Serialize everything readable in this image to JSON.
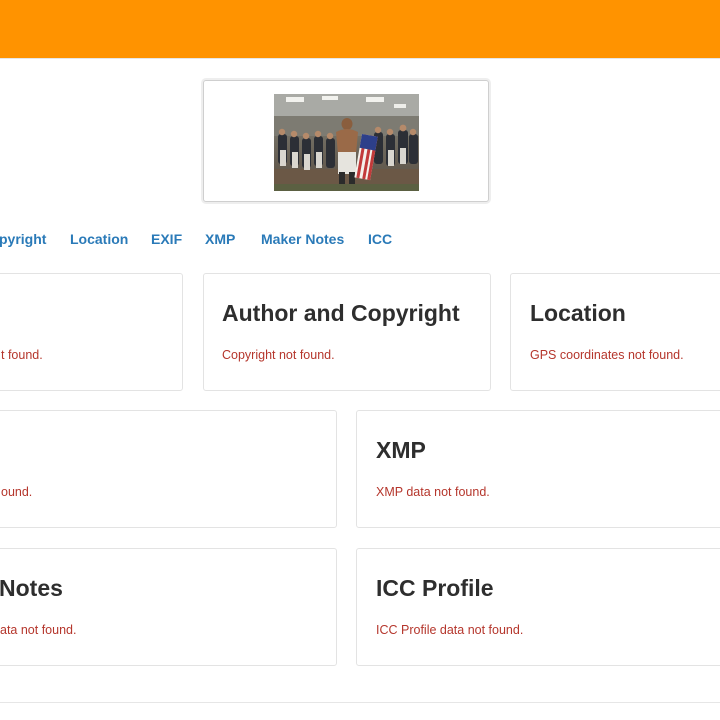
{
  "nav": {
    "links": [
      "pyright",
      "Location",
      "EXIF",
      "XMP",
      "Maker Notes",
      "ICC"
    ]
  },
  "cards": {
    "basic": {
      "title": "",
      "message": "t found."
    },
    "author": {
      "title": "Author and Copyright",
      "message": "Copyright not found."
    },
    "location": {
      "title": "Location",
      "message": "GPS coordinates not found."
    },
    "exif": {
      "title": "",
      "message": "ound."
    },
    "xmp": {
      "title": "XMP",
      "message": "XMP data not found."
    },
    "maker": {
      "title": "Notes",
      "message": "ata not found."
    },
    "icc": {
      "title": "ICC Profile",
      "message": "ICC Profile data not found."
    }
  },
  "colors": {
    "header": "#ff9300",
    "link": "#2a7ab8",
    "error_text": "#b5362c",
    "heading": "#2e2e2e"
  },
  "icons": {
    "thumbnail": "photo-thumbnail"
  }
}
